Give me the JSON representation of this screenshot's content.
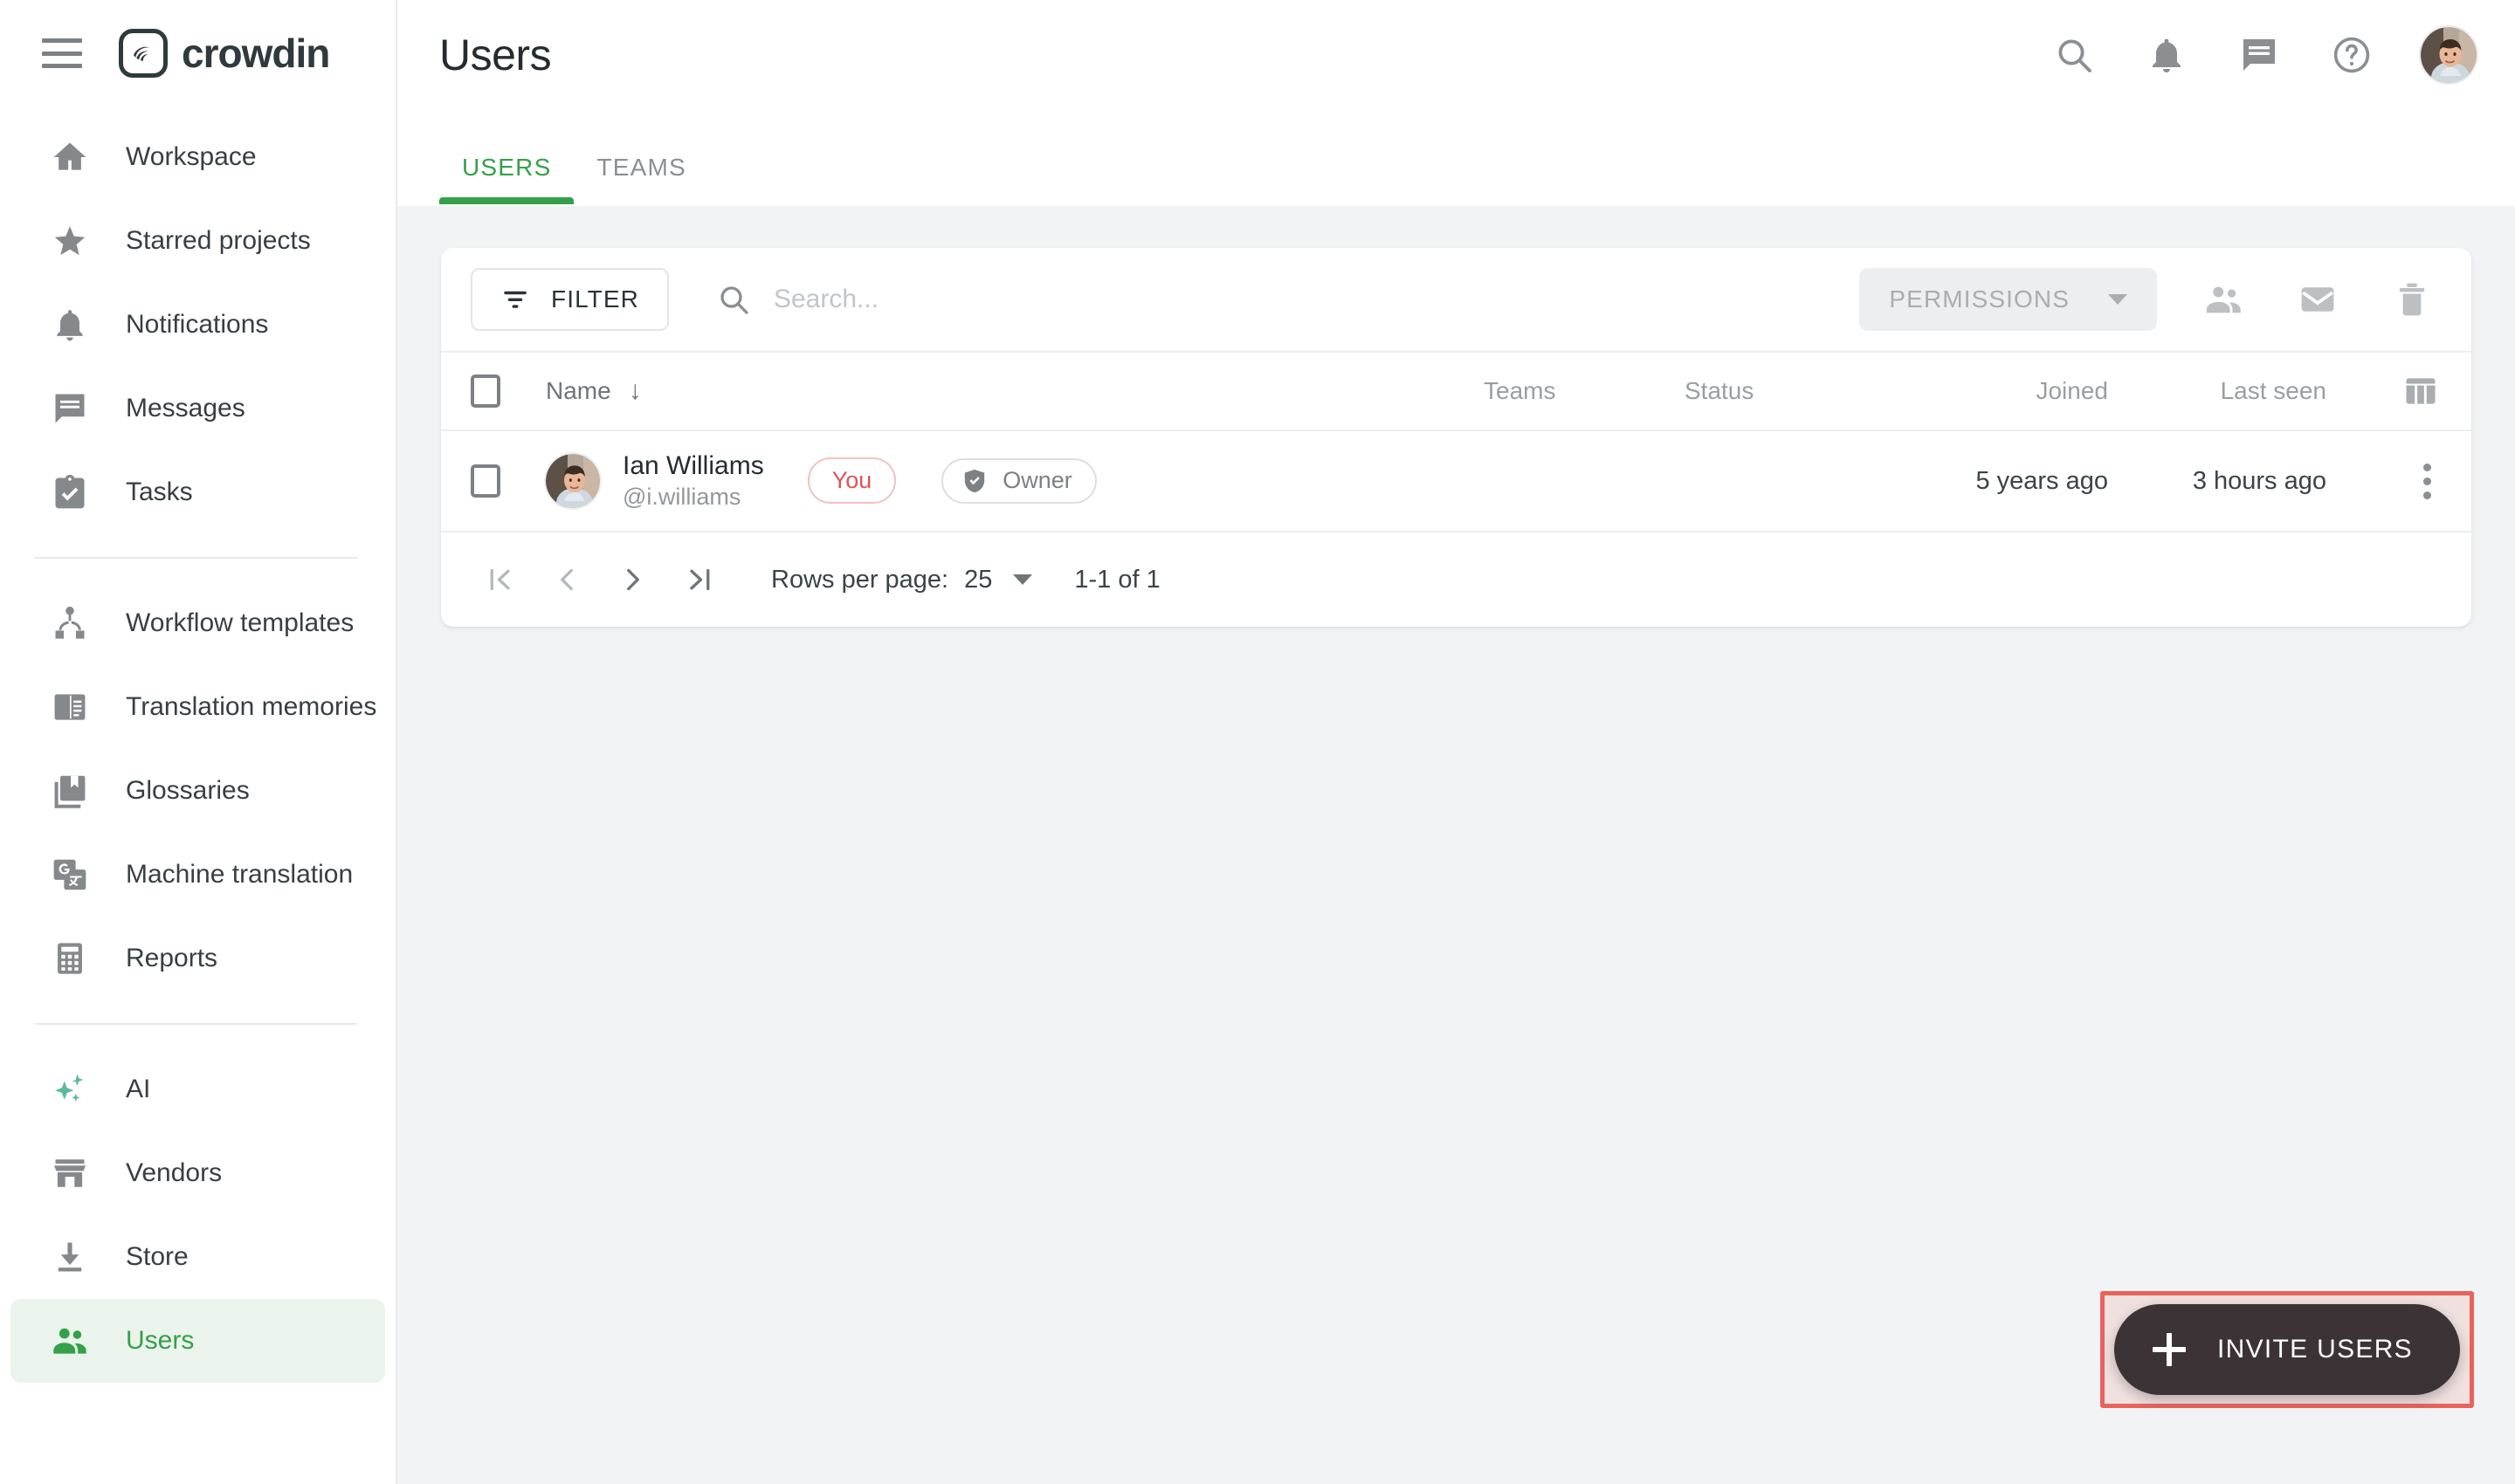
{
  "brand": {
    "name": "crowdin",
    "menu_icon": "hamburger-icon",
    "logo_icon": "crowdin-logo-icon"
  },
  "sidebar": {
    "groups": [
      {
        "items": [
          {
            "label": "Workspace",
            "icon": "home-icon",
            "active": false
          },
          {
            "label": "Starred projects",
            "icon": "star-icon",
            "active": false
          },
          {
            "label": "Notifications",
            "icon": "bell-icon",
            "active": false
          },
          {
            "label": "Messages",
            "icon": "message-icon",
            "active": false
          },
          {
            "label": "Tasks",
            "icon": "tasks-clipboard-icon",
            "active": false
          }
        ]
      },
      {
        "items": [
          {
            "label": "Workflow templates",
            "icon": "workflow-icon",
            "active": false
          },
          {
            "label": "Translation memories",
            "icon": "translation-memory-icon",
            "active": false
          },
          {
            "label": "Glossaries",
            "icon": "glossary-book-icon",
            "active": false
          },
          {
            "label": "Machine translation",
            "icon": "machine-translation-icon",
            "active": false
          },
          {
            "label": "Reports",
            "icon": "reports-calculator-icon",
            "active": false
          }
        ]
      },
      {
        "items": [
          {
            "label": "AI",
            "icon": "ai-sparkle-icon",
            "active": false
          },
          {
            "label": "Vendors",
            "icon": "store-vendor-icon",
            "active": false
          },
          {
            "label": "Store",
            "icon": "download-store-icon",
            "active": false
          },
          {
            "label": "Users",
            "icon": "users-group-icon",
            "active": true
          }
        ]
      }
    ]
  },
  "header": {
    "title": "Users",
    "actions": [
      {
        "name": "search-icon"
      },
      {
        "name": "bell-icon"
      },
      {
        "name": "message-icon"
      },
      {
        "name": "help-icon"
      }
    ],
    "avatar": "user-avatar"
  },
  "tabs": [
    {
      "label": "USERS",
      "active": true
    },
    {
      "label": "TEAMS",
      "active": false
    }
  ],
  "toolbar": {
    "filter_label": "FILTER",
    "search_placeholder": "Search...",
    "search_value": "",
    "permissions_label": "PERMISSIONS",
    "icons": [
      {
        "name": "add-to-team-icon"
      },
      {
        "name": "email-icon"
      },
      {
        "name": "delete-trash-icon"
      }
    ]
  },
  "table": {
    "columns": [
      {
        "key": "name",
        "label": "Name",
        "sorted": true,
        "sort_dir": "↓"
      },
      {
        "key": "teams",
        "label": "Teams"
      },
      {
        "key": "status",
        "label": "Status"
      },
      {
        "key": "joined",
        "label": "Joined"
      },
      {
        "key": "last_seen",
        "label": "Last seen"
      }
    ],
    "columns_settings_icon": "columns-settings-icon",
    "rows": [
      {
        "full_name": "Ian Williams",
        "handle": "@i.williams",
        "badge_you": "You",
        "badge_role": "Owner",
        "teams": "",
        "status": "",
        "joined": "5 years ago",
        "last_seen": "3 hours ago"
      }
    ]
  },
  "pagination": {
    "first_label": "|<",
    "prev_label": "<",
    "next_label": ">",
    "last_label": ">|",
    "rows_per_page_label": "Rows per page:",
    "rows_per_page_value": "25",
    "range_label": "1-1 of 1"
  },
  "fab": {
    "label": "INVITE USERS",
    "icon": "plus-icon"
  },
  "colors": {
    "accent_green": "#35a04a",
    "accent_green_bg": "#eaf4ec",
    "teal_ai": "#5cb9a0",
    "badge_you": "#df5454",
    "fab_bg": "#3b3335",
    "highlight_border": "#e8635c",
    "page_bg": "#f2f3f4"
  }
}
